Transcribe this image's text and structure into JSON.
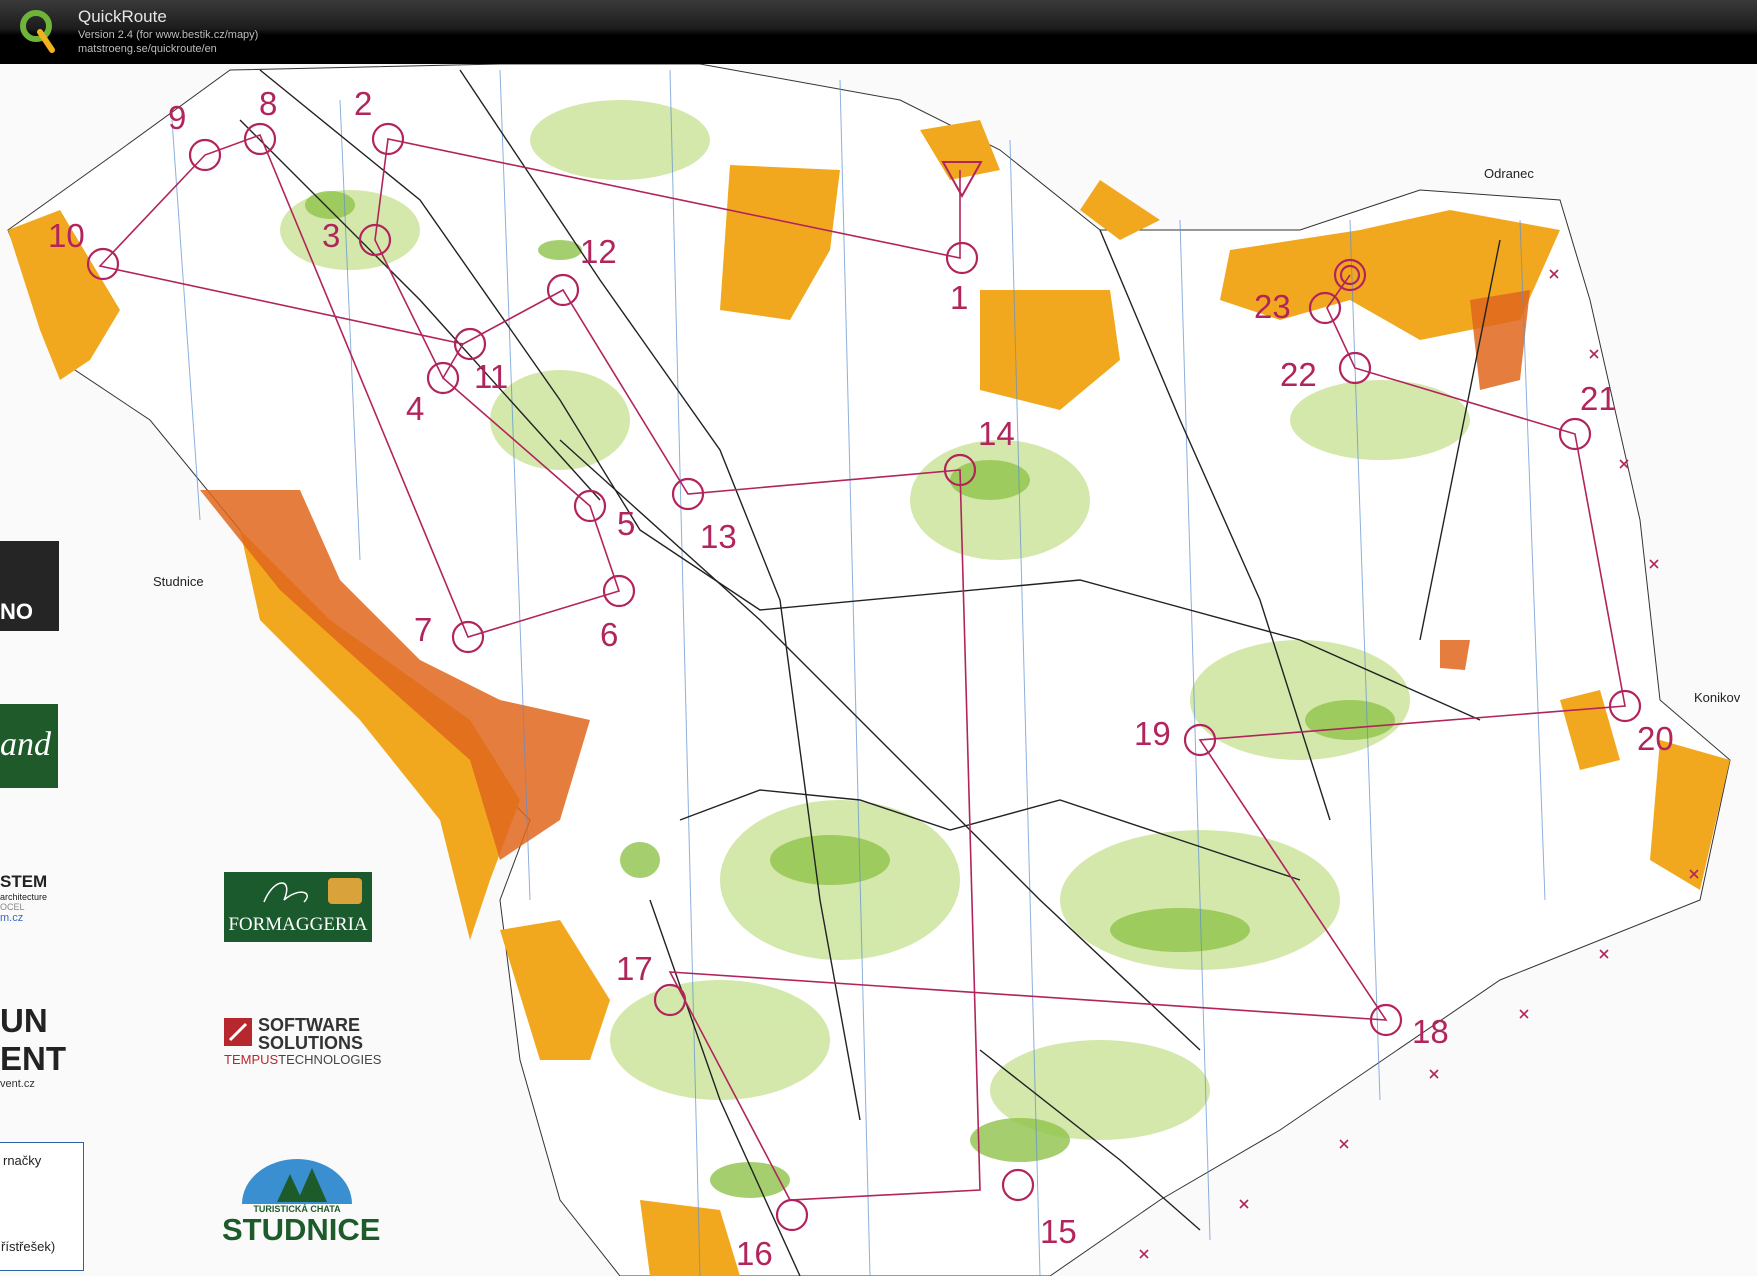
{
  "app": {
    "title": "QuickRoute",
    "version_line": "Version 2.4  (for www.bestik.cz/mapy)",
    "url_line": "matstroeng.se/quickroute/en"
  },
  "places": [
    {
      "name": "Odranec"
    },
    {
      "name": "Studnice"
    },
    {
      "name": "Konikov"
    }
  ],
  "controls": [
    "1",
    "2",
    "3",
    "4",
    "5",
    "6",
    "7",
    "8",
    "9",
    "10",
    "11",
    "12",
    "13",
    "14",
    "15",
    "16",
    "17",
    "18",
    "19",
    "20",
    "21",
    "22",
    "23"
  ],
  "sponsors": {
    "brno": "NO",
    "land": "and",
    "stem_1": "STEM",
    "stem_2": "architecture",
    "stem_3": "OCEL",
    "stem_4": "m.cz",
    "formaggeria": "FORMAGGERIA",
    "software_1": "SOFTWARE",
    "software_2": "SOLUTIONS",
    "tempus_1": "TEMPUS",
    "tempus_2": "TECHNOLOGIES",
    "event_1": "UN",
    "event_2": "ENT",
    "event_url": "vent.cz",
    "studnice_1": "TURISTICKÁ CHATA",
    "studnice_2": "STUDNICE"
  },
  "legend": {
    "line_1": "rnačky",
    "line_2": "řístřešek)"
  },
  "colors": {
    "course": "#b2245c",
    "open_land": "#f2a81e",
    "rough_open": "#f7d46e",
    "forest_green": "#8fc34a",
    "light_green": "#cfe6a3",
    "private_land": "#e0661c",
    "north_lines": "#5c8fd0"
  }
}
